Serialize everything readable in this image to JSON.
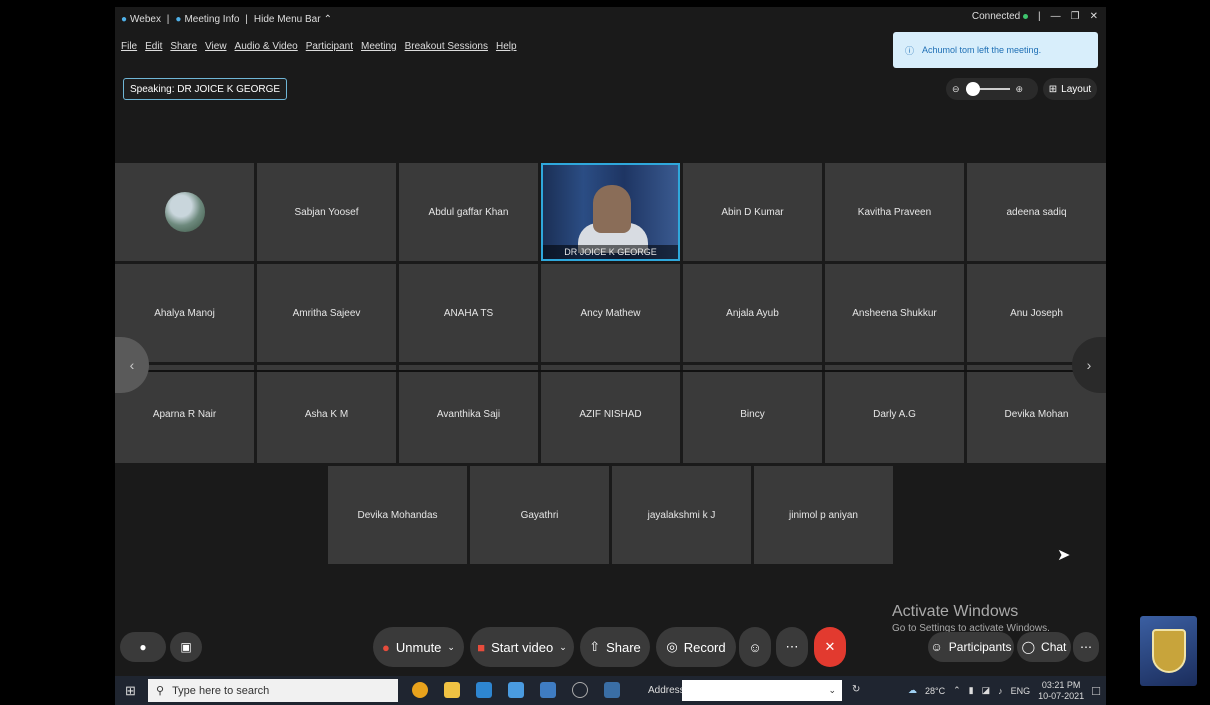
{
  "titlebar": {
    "app": "Webex",
    "meeting_info": "Meeting Info",
    "hide_menu": "Hide Menu Bar",
    "status": "Connected"
  },
  "menu": [
    "File",
    "Edit",
    "Share",
    "View",
    "Audio & Video",
    "Participant",
    "Meeting",
    "Breakout Sessions",
    "Help"
  ],
  "notice": "Achumol tom left the meeting.",
  "speaking": "Speaking: DR JOICE K GEORGE",
  "layout_label": "Layout",
  "grid": {
    "row1": [
      "",
      "Sabjan Yoosef",
      "Abdul gaffar Khan",
      "DR JOICE K GEORGE",
      "Abin D Kumar",
      "Kavitha Praveen",
      "adeena sadiq"
    ],
    "row2": [
      "Ahalya Manoj",
      "Amritha Sajeev",
      "ANAHA TS",
      "Ancy Mathew",
      "Anjala Ayub",
      "Ansheena Shukkur",
      "Anu Joseph"
    ],
    "row3": [
      "Aparna R Nair",
      "Asha K M",
      "Avanthika Saji",
      "AZIF NISHAD",
      "Bincy",
      "Darly A.G",
      "Devika Mohan"
    ],
    "row4": [
      "Devika Mohandas",
      "Gayathri",
      "jayalakshmi k J",
      "jinimol p aniyan"
    ]
  },
  "controls": {
    "unmute": "Unmute",
    "start_video": "Start video",
    "share": "Share",
    "record": "Record",
    "participants": "Participants",
    "chat": "Chat"
  },
  "watermark": {
    "line1": "Activate Windows",
    "line2": "Go to Settings to activate Windows."
  },
  "taskbar": {
    "search_placeholder": "Type here to search",
    "address_label": "Address",
    "temperature": "28°C",
    "language": "ENG",
    "time": "03:21 PM",
    "date": "10-07-2021"
  }
}
